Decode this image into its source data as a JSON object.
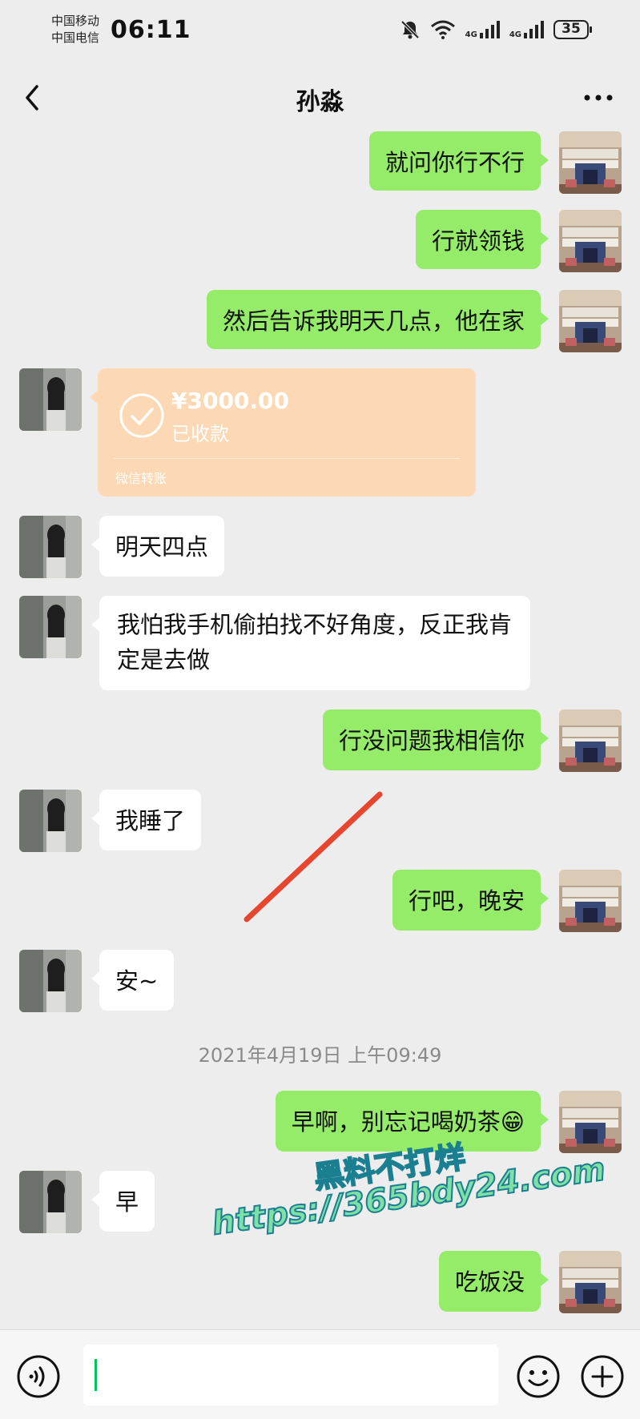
{
  "status": {
    "carrier_1": "中国移动",
    "carrier_2": "中国电信",
    "time": "06:11",
    "network_1": "4G",
    "network_2": "4G",
    "battery": "35",
    "icons": [
      "bell-muted-icon",
      "wifi-icon",
      "signal-4g-icon",
      "signal-4g-icon",
      "battery-icon"
    ]
  },
  "header": {
    "title": "孙淼",
    "back_icon": "chevron-left-icon",
    "more_icon": "more-dots-icon"
  },
  "messages": [
    {
      "from": "me",
      "text": "就问你行不行"
    },
    {
      "from": "me",
      "text": "行就领钱"
    },
    {
      "from": "me",
      "text": "然后告诉我明天几点，他在家"
    },
    {
      "from": "them",
      "type": "transfer",
      "amount": "¥3000.00",
      "status": "已收款",
      "footer": "微信转账"
    },
    {
      "from": "them",
      "text": "明天四点"
    },
    {
      "from": "them",
      "text": "我怕我手机偷拍找不好角度，反正我肯定是去做"
    },
    {
      "from": "me",
      "text": "行没问题我相信你"
    },
    {
      "from": "them",
      "text": "我睡了"
    },
    {
      "from": "me",
      "text": "行吧，晚安"
    },
    {
      "from": "them",
      "text": "安~"
    },
    {
      "from": "me",
      "text": "早啊，别忘记喝奶茶😁"
    },
    {
      "from": "them",
      "text": "早"
    },
    {
      "from": "me",
      "text": "吃饭没"
    }
  ],
  "timestamp": "2021年4月19日 上午09:49",
  "watermark": {
    "line_1": "黑料不打烊",
    "line_2": "https://365bdy24.com"
  },
  "input_bar": {
    "value": "",
    "voice_icon": "voice-icon",
    "emoji_icon": "emoji-icon",
    "plus_icon": "plus-circle-icon"
  },
  "colors": {
    "background": "#ededed",
    "my_bubble": "#95ec69",
    "their_bubble": "#ffffff",
    "transfer_card": "#fcd9b4",
    "annotation_line": "#e8452e"
  }
}
